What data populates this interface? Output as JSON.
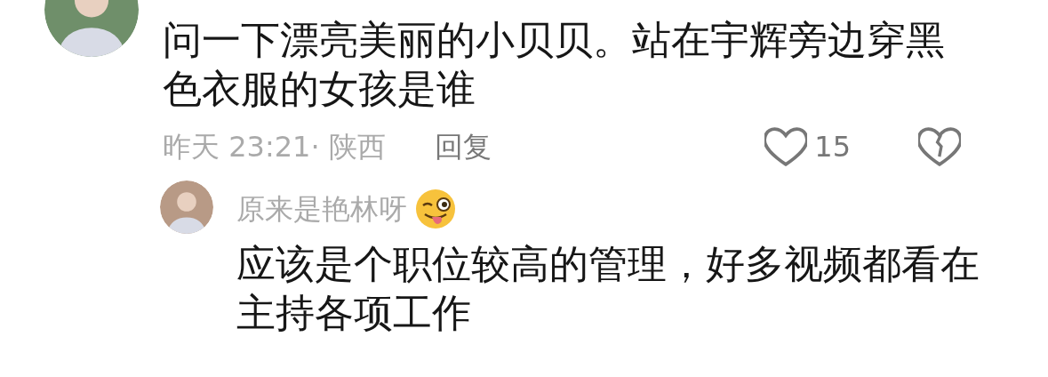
{
  "comment": {
    "text": "问一下漂亮美丽的小贝贝。站在宇辉旁边穿黑色衣服的女孩是谁",
    "time": "昨天 23:21· 陕西",
    "reply_label": "回复",
    "likes": "15",
    "replies": [
      {
        "author": "原来是艳林呀",
        "text": "应该是个职位较高的管理，好多视频都看在主持各项工作"
      }
    ]
  }
}
